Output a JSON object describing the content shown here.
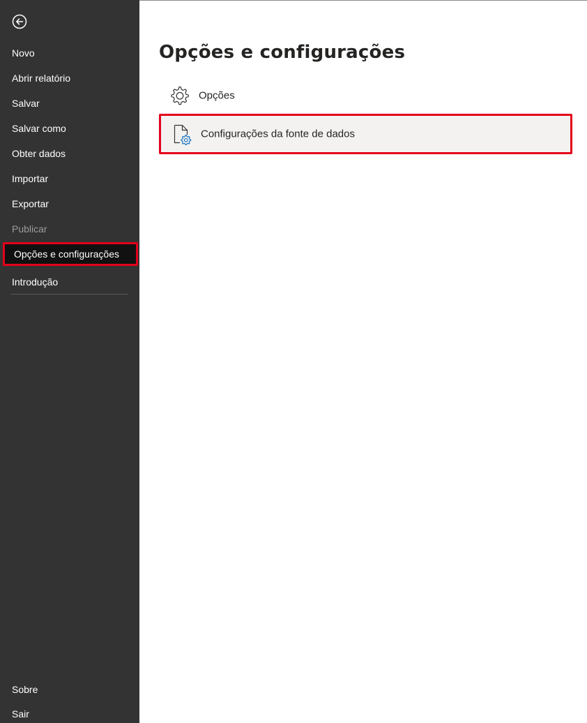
{
  "sidebar": {
    "back_icon": "back-arrow-icon",
    "items": [
      {
        "label": "Novo",
        "state": "normal"
      },
      {
        "label": "Abrir relatório",
        "state": "normal"
      },
      {
        "label": "Salvar",
        "state": "normal"
      },
      {
        "label": "Salvar como",
        "state": "normal"
      },
      {
        "label": "Obter dados",
        "state": "normal"
      },
      {
        "label": "Importar",
        "state": "normal"
      },
      {
        "label": "Exportar",
        "state": "normal"
      },
      {
        "label": "Publicar",
        "state": "disabled"
      },
      {
        "label": "Opções e configurações",
        "state": "selected"
      },
      {
        "label": "Introdução",
        "state": "normal"
      }
    ],
    "footer_items": [
      {
        "label": "Sobre"
      },
      {
        "label": "Sair"
      }
    ]
  },
  "main": {
    "title": "Opções e configurações",
    "options": [
      {
        "label": "Opções",
        "icon": "gear-icon",
        "highlighted": false
      },
      {
        "label": "Configurações da fonte de dados",
        "icon": "data-source-settings-icon",
        "highlighted": true
      }
    ]
  },
  "colors": {
    "sidebar_bg": "#333333",
    "highlight_border": "#e3001b",
    "highlight_row_bg": "#f3f2f1",
    "icon_accent": "#0f6cbd"
  }
}
